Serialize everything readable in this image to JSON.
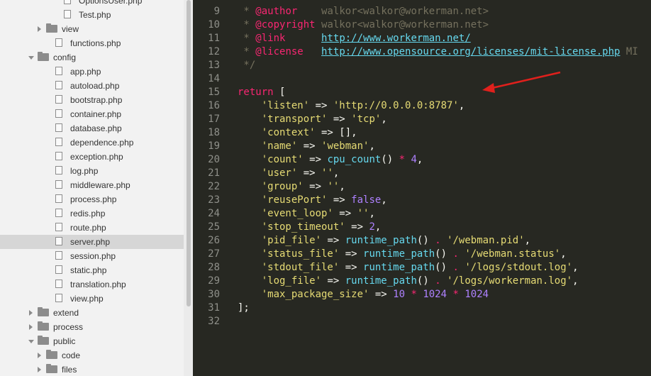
{
  "sidebar": {
    "items": [
      {
        "label": "OptionsUser.php",
        "type": "file",
        "depth": 2
      },
      {
        "label": "Test.php",
        "type": "file",
        "depth": 2
      },
      {
        "label": "view",
        "type": "folder",
        "depth": 1,
        "expanded": false
      },
      {
        "label": "functions.php",
        "type": "file",
        "depth": 1
      },
      {
        "label": "config",
        "type": "folder",
        "depth": 0,
        "expanded": true
      },
      {
        "label": "app.php",
        "type": "file",
        "depth": 1
      },
      {
        "label": "autoload.php",
        "type": "file",
        "depth": 1
      },
      {
        "label": "bootstrap.php",
        "type": "file",
        "depth": 1
      },
      {
        "label": "container.php",
        "type": "file",
        "depth": 1
      },
      {
        "label": "database.php",
        "type": "file",
        "depth": 1
      },
      {
        "label": "dependence.php",
        "type": "file",
        "depth": 1
      },
      {
        "label": "exception.php",
        "type": "file",
        "depth": 1
      },
      {
        "label": "log.php",
        "type": "file",
        "depth": 1
      },
      {
        "label": "middleware.php",
        "type": "file",
        "depth": 1
      },
      {
        "label": "process.php",
        "type": "file",
        "depth": 1
      },
      {
        "label": "redis.php",
        "type": "file",
        "depth": 1
      },
      {
        "label": "route.php",
        "type": "file",
        "depth": 1
      },
      {
        "label": "server.php",
        "type": "file",
        "depth": 1,
        "active": true
      },
      {
        "label": "session.php",
        "type": "file",
        "depth": 1
      },
      {
        "label": "static.php",
        "type": "file",
        "depth": 1
      },
      {
        "label": "translation.php",
        "type": "file",
        "depth": 1
      },
      {
        "label": "view.php",
        "type": "file",
        "depth": 1
      },
      {
        "label": "extend",
        "type": "folder",
        "depth": 0,
        "expanded": false
      },
      {
        "label": "process",
        "type": "folder",
        "depth": 0,
        "expanded": false
      },
      {
        "label": "public",
        "type": "folder",
        "depth": 0,
        "expanded": true
      },
      {
        "label": "code",
        "type": "folder",
        "depth": 1,
        "expanded": false
      },
      {
        "label": "files",
        "type": "folder",
        "depth": 1,
        "expanded": false
      }
    ]
  },
  "editor": {
    "lines": [
      {
        "n": "9",
        "tokens": [
          [
            "c-comment",
            " * "
          ],
          [
            "c-tag",
            "@author"
          ],
          [
            "c-comment",
            "    walkor<walkor@workerman.net>"
          ]
        ]
      },
      {
        "n": "10",
        "tokens": [
          [
            "c-comment",
            " * "
          ],
          [
            "c-tag",
            "@copyright"
          ],
          [
            "c-comment",
            " walkor<walkor@workerman.net>"
          ]
        ]
      },
      {
        "n": "11",
        "tokens": [
          [
            "c-comment",
            " * "
          ],
          [
            "c-tag",
            "@link"
          ],
          [
            "c-comment",
            "      "
          ],
          [
            "c-link",
            "http://www.workerman.net/"
          ]
        ]
      },
      {
        "n": "12",
        "tokens": [
          [
            "c-comment",
            " * "
          ],
          [
            "c-tag",
            "@license"
          ],
          [
            "c-comment",
            "   "
          ],
          [
            "c-link",
            "http://www.opensource.org/licenses/mit-license.php"
          ],
          [
            "c-comment",
            " MI"
          ]
        ]
      },
      {
        "n": "13",
        "tokens": [
          [
            "c-comment",
            " */"
          ]
        ]
      },
      {
        "n": "14",
        "tokens": []
      },
      {
        "n": "15",
        "tokens": [
          [
            "c-kw",
            "return"
          ],
          [
            "c-punct",
            " ["
          ]
        ]
      },
      {
        "n": "16",
        "tokens": [
          [
            "c-punct",
            "    "
          ],
          [
            "c-str",
            "'listen'"
          ],
          [
            "c-punct",
            " => "
          ],
          [
            "c-str",
            "'http://0.0.0.0:8787'"
          ],
          [
            "c-punct",
            ","
          ]
        ]
      },
      {
        "n": "17",
        "tokens": [
          [
            "c-punct",
            "    "
          ],
          [
            "c-str",
            "'transport'"
          ],
          [
            "c-punct",
            " => "
          ],
          [
            "c-str",
            "'tcp'"
          ],
          [
            "c-punct",
            ","
          ]
        ]
      },
      {
        "n": "18",
        "tokens": [
          [
            "c-punct",
            "    "
          ],
          [
            "c-str",
            "'context'"
          ],
          [
            "c-punct",
            " => [],"
          ]
        ]
      },
      {
        "n": "19",
        "tokens": [
          [
            "c-punct",
            "    "
          ],
          [
            "c-str",
            "'name'"
          ],
          [
            "c-punct",
            " => "
          ],
          [
            "c-str",
            "'webman'"
          ],
          [
            "c-punct",
            ","
          ]
        ]
      },
      {
        "n": "20",
        "tokens": [
          [
            "c-punct",
            "    "
          ],
          [
            "c-str",
            "'count'"
          ],
          [
            "c-punct",
            " => "
          ],
          [
            "c-fn",
            "cpu_count"
          ],
          [
            "c-punct",
            "() "
          ],
          [
            "c-op",
            "*"
          ],
          [
            "c-punct",
            " "
          ],
          [
            "c-num",
            "4"
          ],
          [
            "c-punct",
            ","
          ]
        ]
      },
      {
        "n": "21",
        "tokens": [
          [
            "c-punct",
            "    "
          ],
          [
            "c-str",
            "'user'"
          ],
          [
            "c-punct",
            " => "
          ],
          [
            "c-str",
            "''"
          ],
          [
            "c-punct",
            ","
          ]
        ]
      },
      {
        "n": "22",
        "tokens": [
          [
            "c-punct",
            "    "
          ],
          [
            "c-str",
            "'group'"
          ],
          [
            "c-punct",
            " => "
          ],
          [
            "c-str",
            "''"
          ],
          [
            "c-punct",
            ","
          ]
        ]
      },
      {
        "n": "23",
        "tokens": [
          [
            "c-punct",
            "    "
          ],
          [
            "c-str",
            "'reusePort'"
          ],
          [
            "c-punct",
            " => "
          ],
          [
            "c-num",
            "false"
          ],
          [
            "c-punct",
            ","
          ]
        ]
      },
      {
        "n": "24",
        "tokens": [
          [
            "c-punct",
            "    "
          ],
          [
            "c-str",
            "'event_loop'"
          ],
          [
            "c-punct",
            " => "
          ],
          [
            "c-str",
            "''"
          ],
          [
            "c-punct",
            ","
          ]
        ]
      },
      {
        "n": "25",
        "tokens": [
          [
            "c-punct",
            "    "
          ],
          [
            "c-str",
            "'stop_timeout'"
          ],
          [
            "c-punct",
            " => "
          ],
          [
            "c-num",
            "2"
          ],
          [
            "c-punct",
            ","
          ]
        ]
      },
      {
        "n": "26",
        "tokens": [
          [
            "c-punct",
            "    "
          ],
          [
            "c-str",
            "'pid_file'"
          ],
          [
            "c-punct",
            " => "
          ],
          [
            "c-fn",
            "runtime_path"
          ],
          [
            "c-punct",
            "() "
          ],
          [
            "c-op",
            "."
          ],
          [
            "c-punct",
            " "
          ],
          [
            "c-str",
            "'/webman.pid'"
          ],
          [
            "c-punct",
            ","
          ]
        ]
      },
      {
        "n": "27",
        "tokens": [
          [
            "c-punct",
            "    "
          ],
          [
            "c-str",
            "'status_file'"
          ],
          [
            "c-punct",
            " => "
          ],
          [
            "c-fn",
            "runtime_path"
          ],
          [
            "c-punct",
            "() "
          ],
          [
            "c-op",
            "."
          ],
          [
            "c-punct",
            " "
          ],
          [
            "c-str",
            "'/webman.status'"
          ],
          [
            "c-punct",
            ","
          ]
        ]
      },
      {
        "n": "28",
        "tokens": [
          [
            "c-punct",
            "    "
          ],
          [
            "c-str",
            "'stdout_file'"
          ],
          [
            "c-punct",
            " => "
          ],
          [
            "c-fn",
            "runtime_path"
          ],
          [
            "c-punct",
            "() "
          ],
          [
            "c-op",
            "."
          ],
          [
            "c-punct",
            " "
          ],
          [
            "c-str",
            "'/logs/stdout.log'"
          ],
          [
            "c-punct",
            ","
          ]
        ]
      },
      {
        "n": "29",
        "tokens": [
          [
            "c-punct",
            "    "
          ],
          [
            "c-str",
            "'log_file'"
          ],
          [
            "c-punct",
            " => "
          ],
          [
            "c-fn",
            "runtime_path"
          ],
          [
            "c-punct",
            "() "
          ],
          [
            "c-op",
            "."
          ],
          [
            "c-punct",
            " "
          ],
          [
            "c-str",
            "'/logs/workerman.log'"
          ],
          [
            "c-punct",
            ","
          ]
        ]
      },
      {
        "n": "30",
        "tokens": [
          [
            "c-punct",
            "    "
          ],
          [
            "c-str",
            "'max_package_size'"
          ],
          [
            "c-punct",
            " => "
          ],
          [
            "c-num",
            "10"
          ],
          [
            "c-punct",
            " "
          ],
          [
            "c-op",
            "*"
          ],
          [
            "c-punct",
            " "
          ],
          [
            "c-num",
            "1024"
          ],
          [
            "c-punct",
            " "
          ],
          [
            "c-op",
            "*"
          ],
          [
            "c-punct",
            " "
          ],
          [
            "c-num",
            "1024"
          ]
        ]
      },
      {
        "n": "31",
        "tokens": [
          [
            "c-punct",
            "];"
          ]
        ]
      },
      {
        "n": "32",
        "tokens": []
      }
    ],
    "annotation_color": "#e0201c"
  }
}
